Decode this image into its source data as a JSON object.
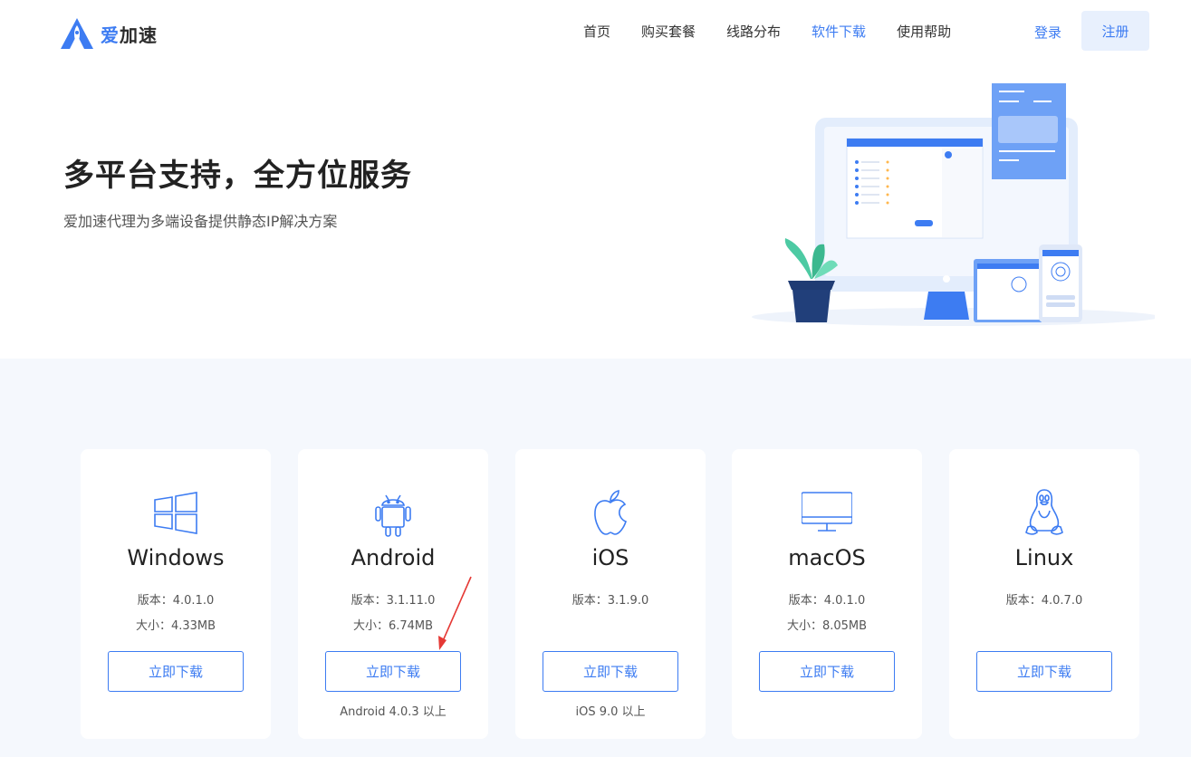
{
  "header": {
    "logo_text_accent": "爱",
    "logo_text_rest": "加速",
    "nav": [
      "首页",
      "购买套餐",
      "线路分布",
      "软件下载",
      "使用帮助"
    ],
    "active_nav": "软件下载",
    "login": "登录",
    "register": "注册"
  },
  "hero": {
    "title": "多平台支持，全方位服务",
    "subtitle": "爱加速代理为多端设备提供静态IP解决方案"
  },
  "platforms": [
    {
      "name": "Windows",
      "version": "版本：4.0.1.0",
      "size": "大小：4.33MB",
      "button": "立即下载",
      "requirement": "",
      "icon": "windows-icon"
    },
    {
      "name": "Android",
      "version": "版本：3.1.11.0",
      "size": "大小：6.74MB",
      "button": "立即下载",
      "requirement": "Android 4.0.3 以上",
      "icon": "android-icon"
    },
    {
      "name": "iOS",
      "version": "版本：3.1.9.0",
      "size": "",
      "button": "立即下载",
      "requirement": "iOS 9.0 以上",
      "icon": "apple-icon"
    },
    {
      "name": "macOS",
      "version": "版本：4.0.1.0",
      "size": "大小：8.05MB",
      "button": "立即下载",
      "requirement": "",
      "icon": "monitor-icon"
    },
    {
      "name": "Linux",
      "version": "版本：4.0.7.0",
      "size": "",
      "button": "立即下载",
      "requirement": "",
      "icon": "linux-penguin-icon"
    }
  ],
  "colors": {
    "accent": "#3d7cf2",
    "section_bg": "#f5f8fd",
    "annotation_arrow": "#e53935"
  }
}
